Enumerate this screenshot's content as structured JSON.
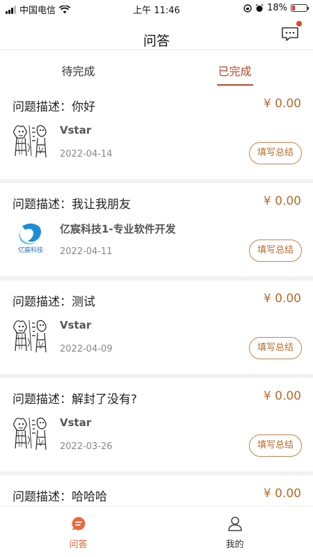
{
  "status_bar": {
    "carrier": "中国电信",
    "time": "上午 11:46",
    "battery": "18%"
  },
  "nav": {
    "title": "问答",
    "has_notification": true
  },
  "tabs": [
    {
      "label": "待完成",
      "active": false
    },
    {
      "label": "已完成",
      "active": true
    }
  ],
  "items": [
    {
      "question": "问题描述：你好",
      "price": "¥ 0.00",
      "name": "Vstar",
      "date": "2022-04-14",
      "avatar": "sketch",
      "action": "填写总结"
    },
    {
      "question": "问题描述：我让我朋友",
      "price": "¥ 0.00",
      "name": "亿宸科技1-专业软件开发",
      "date": "2022-04-11",
      "avatar": "company-logo",
      "action": "填写总结"
    },
    {
      "question": "问题描述：测试",
      "price": "¥ 0.00",
      "name": "Vstar",
      "date": "2022-04-09",
      "avatar": "sketch",
      "action": "填写总结"
    },
    {
      "question": "问题描述：解封了没有?",
      "price": "¥ 0.00",
      "name": "Vstar",
      "date": "2022-03-26",
      "avatar": "sketch",
      "action": "填写总结"
    },
    {
      "question": "问题描述：哈哈哈",
      "price": "¥ 0.00",
      "name": "",
      "date": "",
      "avatar": "",
      "action": ""
    }
  ],
  "logo_text": "亿宸科技",
  "bottom_tabs": [
    {
      "label": "问答",
      "icon": "chat-bubble-icon",
      "active": true
    },
    {
      "label": "我的",
      "icon": "user-icon",
      "active": false
    }
  ],
  "colors": {
    "accent": "#b0482a",
    "price": "#b86b2a",
    "active_bottom": "#e0632f"
  }
}
